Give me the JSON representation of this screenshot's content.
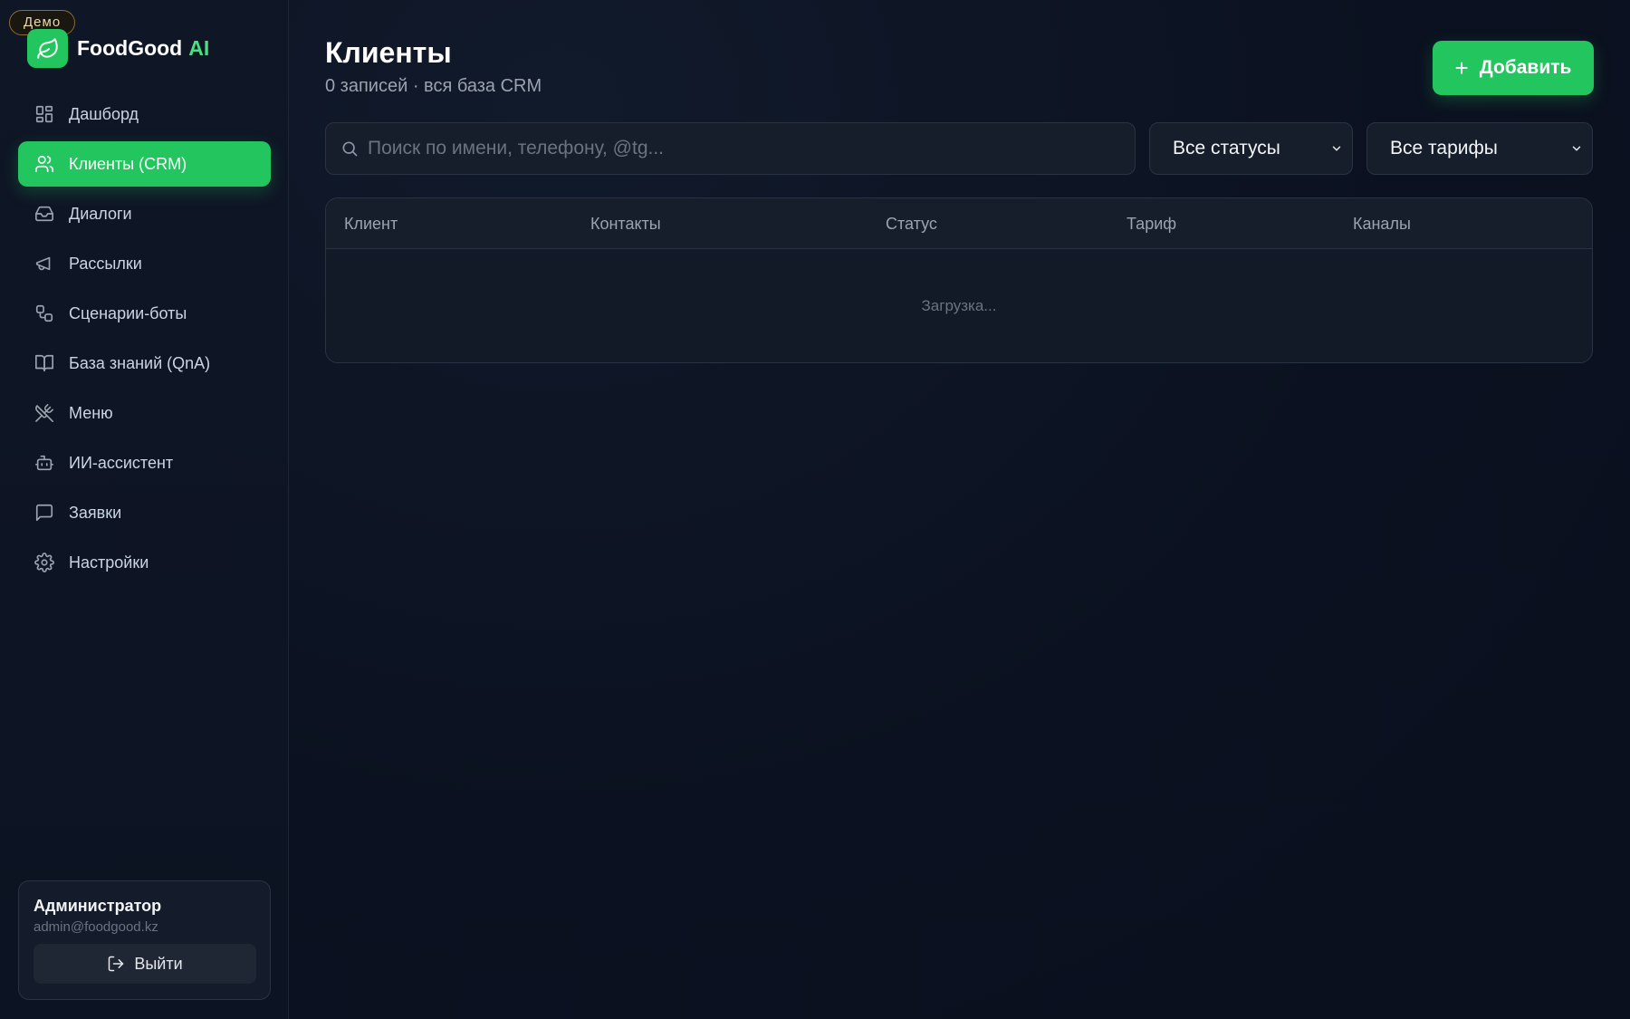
{
  "badge": "Демо",
  "brand": {
    "name": "FoodGood",
    "accent": "AI",
    "color": "#22c55e"
  },
  "sidebar": {
    "items": [
      {
        "label": "Дашборд",
        "icon": "dashboard-icon"
      },
      {
        "label": "Клиенты (CRM)",
        "icon": "users-icon",
        "active": true
      },
      {
        "label": "Диалоги",
        "icon": "inbox-icon"
      },
      {
        "label": "Рассылки",
        "icon": "megaphone-icon"
      },
      {
        "label": "Сценарии-боты",
        "icon": "workflow-icon"
      },
      {
        "label": "База знаний (QnA)",
        "icon": "book-icon"
      },
      {
        "label": "Меню",
        "icon": "utensils-icon"
      },
      {
        "label": "ИИ-ассистент",
        "icon": "bot-icon"
      },
      {
        "label": "Заявки",
        "icon": "message-icon"
      },
      {
        "label": "Настройки",
        "icon": "gear-icon"
      }
    ]
  },
  "user": {
    "name": "Администратор",
    "email": "admin@foodgood.kz",
    "logout_label": "Выйти"
  },
  "main": {
    "title": "Клиенты",
    "subtitle": "0 записей · вся база CRM",
    "add_label": "Добавить",
    "search": {
      "placeholder": "Поиск по имени, телефону, @tg...",
      "value": ""
    },
    "status_filter": "Все статусы",
    "tariff_filter": "Все тарифы",
    "table": {
      "columns": [
        "Клиент",
        "Контакты",
        "Статус",
        "Тариф",
        "Каналы"
      ],
      "loading_text": "Загрузка..."
    }
  }
}
